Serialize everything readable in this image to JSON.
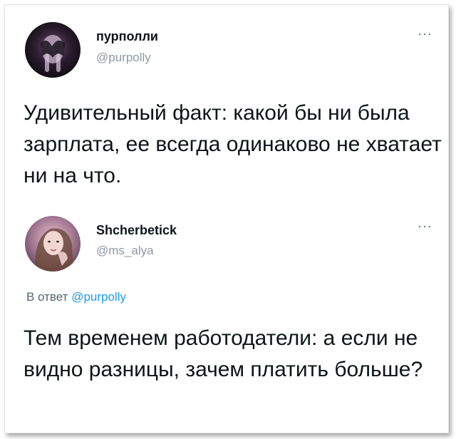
{
  "tweets": [
    {
      "display_name": "пурполли",
      "handle": "@purpolly",
      "more_label": "···",
      "text": "Удивительный факт: какой бы ни была зарплата, ее всегда одинаково не хватает ни на что."
    },
    {
      "display_name": "Shcherbetick",
      "handle": "@ms_alya",
      "more_label": "···",
      "reply_prefix": "В ответ",
      "reply_mention": "@purpolly",
      "text": "Тем временем работодатели: а если не видно разницы, зачем платить больше?"
    }
  ],
  "colors": {
    "name": "#0f1419",
    "handle": "#8b98a5",
    "link": "#1d9bf0"
  },
  "icons": {
    "more": "more-horizontal-icon"
  }
}
